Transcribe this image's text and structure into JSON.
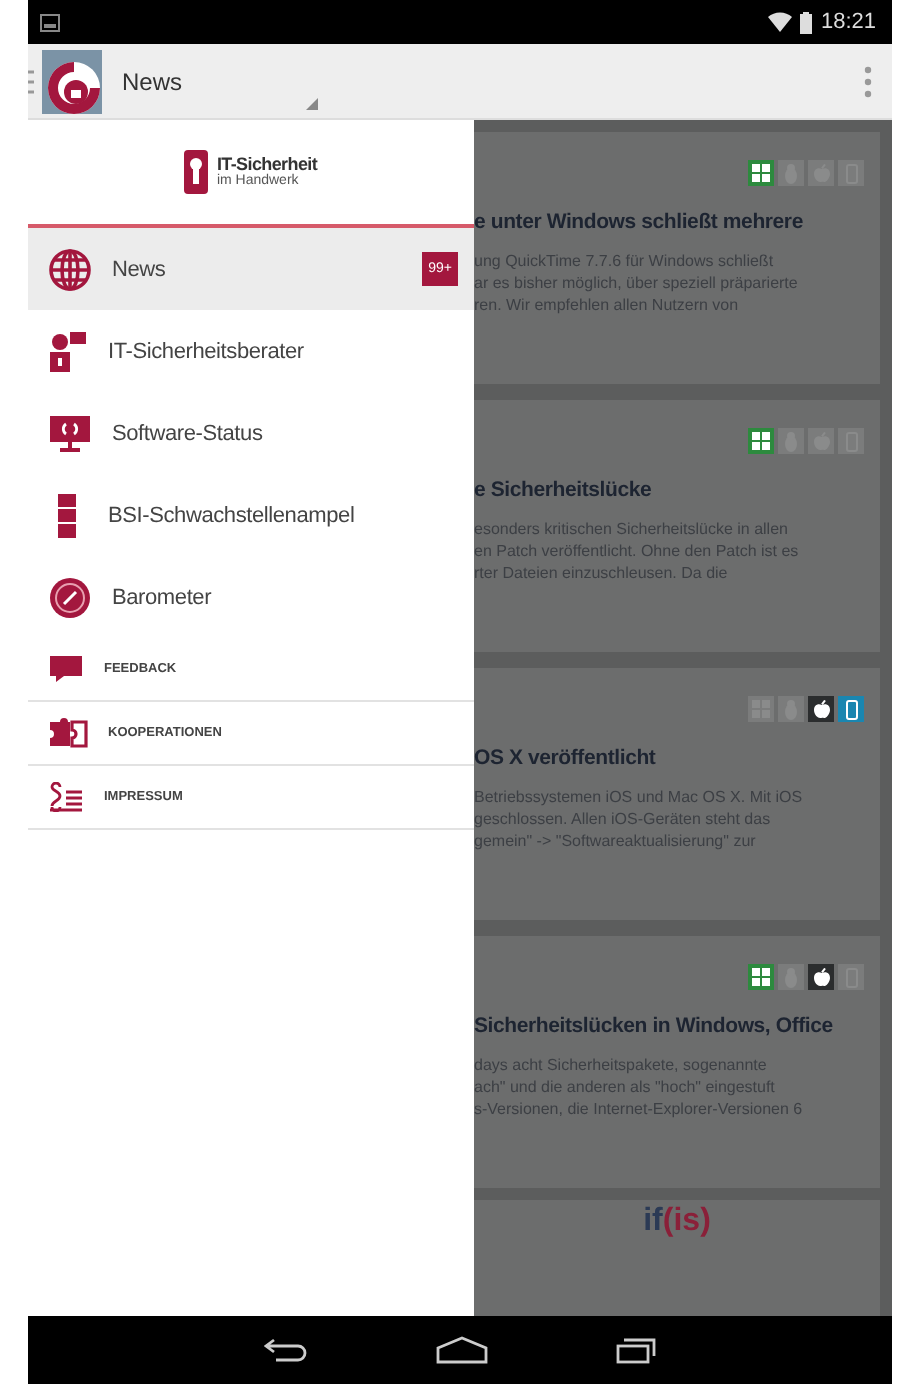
{
  "status_bar": {
    "time": "18:21"
  },
  "action_bar": {
    "title": "News"
  },
  "drawer": {
    "logo": {
      "line1": "IT-Sicherheit",
      "line2": "im Handwerk"
    },
    "items": [
      {
        "kind": "large",
        "label": "News",
        "selected": true,
        "badge": "99+"
      },
      {
        "kind": "large",
        "label": "IT-Sicherheitsberater",
        "selected": false
      },
      {
        "kind": "large",
        "label": "Software-Status",
        "selected": false
      },
      {
        "kind": "large",
        "label": "BSI-Schwachstellenampel",
        "selected": false
      },
      {
        "kind": "large",
        "label": "Barometer",
        "selected": false
      },
      {
        "kind": "small",
        "label": "FEEDBACK",
        "selected": false
      },
      {
        "kind": "small",
        "label": "KOOPERATIONEN",
        "selected": false
      },
      {
        "kind": "small",
        "label": "IMPRESSUM",
        "selected": false
      }
    ]
  },
  "news": {
    "cards": [
      {
        "title": "e unter Windows schließt mehrere",
        "lines": [
          "ung QuickTime 7.7.6 für Windows schließt",
          "ar es bisher möglich, über speziell präparierte",
          "ren. Wir empfehlen allen Nutzern von"
        ],
        "platforms": [
          {
            "kind": "windows",
            "active": true
          },
          {
            "kind": "linux",
            "active": false
          },
          {
            "kind": "apple",
            "active": false
          },
          {
            "kind": "mobile",
            "active": false
          }
        ]
      },
      {
        "title": "e Sicherheitslücke",
        "lines": [
          "esonders kritischen Sicherheitslücke in allen",
          "en Patch veröffentlicht. Ohne den Patch ist es",
          "rter Dateien einzuschleusen. Da die"
        ],
        "platforms": [
          {
            "kind": "windows",
            "active": true
          },
          {
            "kind": "linux",
            "active": false
          },
          {
            "kind": "apple",
            "active": false
          },
          {
            "kind": "mobile",
            "active": false
          }
        ]
      },
      {
        "title": "OS X veröffentlicht",
        "lines": [
          "Betriebssystemen iOS und Mac OS X. Mit iOS",
          "geschlossen. Allen iOS-Geräten steht das",
          "gemein\" -> \"Softwareaktualisierung\" zur"
        ],
        "platforms": [
          {
            "kind": "windows",
            "active": false
          },
          {
            "kind": "linux",
            "active": false
          },
          {
            "kind": "apple",
            "active": true
          },
          {
            "kind": "mobile",
            "active": true
          }
        ]
      },
      {
        "title": "Sicherheitslücken in Windows, Office",
        "lines": [
          "days acht Sicherheitspakete, sogenannte",
          "ach\" und die anderen als \"hoch\" eingestuft",
          "s-Versionen, die Internet-Explorer-Versionen 6"
        ],
        "platforms": [
          {
            "kind": "windows",
            "active": true
          },
          {
            "kind": "linux",
            "active": false
          },
          {
            "kind": "apple",
            "active": true
          },
          {
            "kind": "mobile",
            "active": false
          }
        ]
      }
    ],
    "footer": {
      "prefix": "if",
      "accent": "(is)"
    }
  }
}
